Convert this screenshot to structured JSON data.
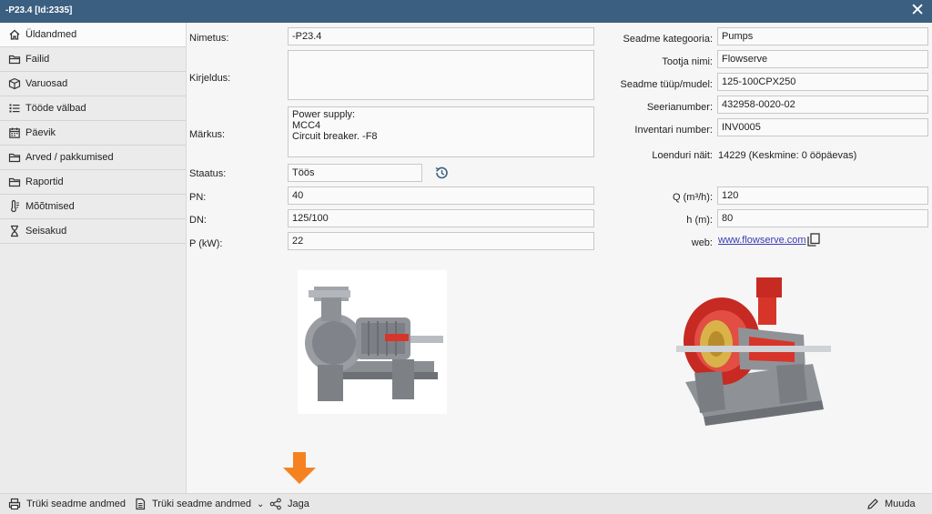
{
  "window": {
    "title": "-P23.4 [Id:2335]"
  },
  "sidebar": {
    "items": [
      {
        "label": "Üldandmed",
        "icon": "home-icon"
      },
      {
        "label": "Failid",
        "icon": "folder-icon"
      },
      {
        "label": "Varuosad",
        "icon": "box-icon"
      },
      {
        "label": "Tööde välbad",
        "icon": "list-icon"
      },
      {
        "label": "Päevik",
        "icon": "calendar-icon"
      },
      {
        "label": "Arved / pakkumised",
        "icon": "folder-icon"
      },
      {
        "label": "Raportid",
        "icon": "folder-icon"
      },
      {
        "label": "Mõõtmised",
        "icon": "thermometer-icon"
      },
      {
        "label": "Seisakud",
        "icon": "hourglass-icon"
      }
    ]
  },
  "left_form": {
    "nimetus_label": "Nimetus:",
    "nimetus_value": "-P23.4",
    "kirjeldus_label": "Kirjeldus:",
    "kirjeldus_value": "",
    "markus_label": "Märkus:",
    "markus_lines": [
      "Power supply:",
      "MCC4",
      "Circuit breaker. -F8"
    ],
    "staatus_label": "Staatus:",
    "staatus_value": "Töös",
    "pn_label": "PN:",
    "pn_value": "40",
    "dn_label": "DN:",
    "dn_value": "125/100",
    "p_label": "P (kW):",
    "p_value": "22"
  },
  "right_form": {
    "kategooria_label": "Seadme kategooria:",
    "kategooria_value": "Pumps",
    "tootja_label": "Tootja nimi:",
    "tootja_value": "Flowserve",
    "tuup_label": "Seadme tüüp/mudel:",
    "tuup_value": "125-100CPX250",
    "seeria_label": "Seerianumber:",
    "seeria_value": "432958-0020-02",
    "inventar_label": "Inventari number:",
    "inventar_value": "INV0005",
    "loendur_label": "Loenduri näit:",
    "loendur_value": "14229 (Keskmine: 0 ööpäevas)",
    "q_label": "Q (m³/h):",
    "q_value": "120",
    "h_label": "h (m):",
    "h_value": "80",
    "web_label": "web:",
    "web_value": "www.flowserve.com"
  },
  "bottom": {
    "print1": "Trüki seadme andmed",
    "print2": "Trüki seadme andmed",
    "share": "Jaga",
    "edit": "Muuda"
  },
  "colors": {
    "titlebar": "#3b5f80",
    "highlight_arrow": "#f58220",
    "pump_red": "#d8352a"
  }
}
